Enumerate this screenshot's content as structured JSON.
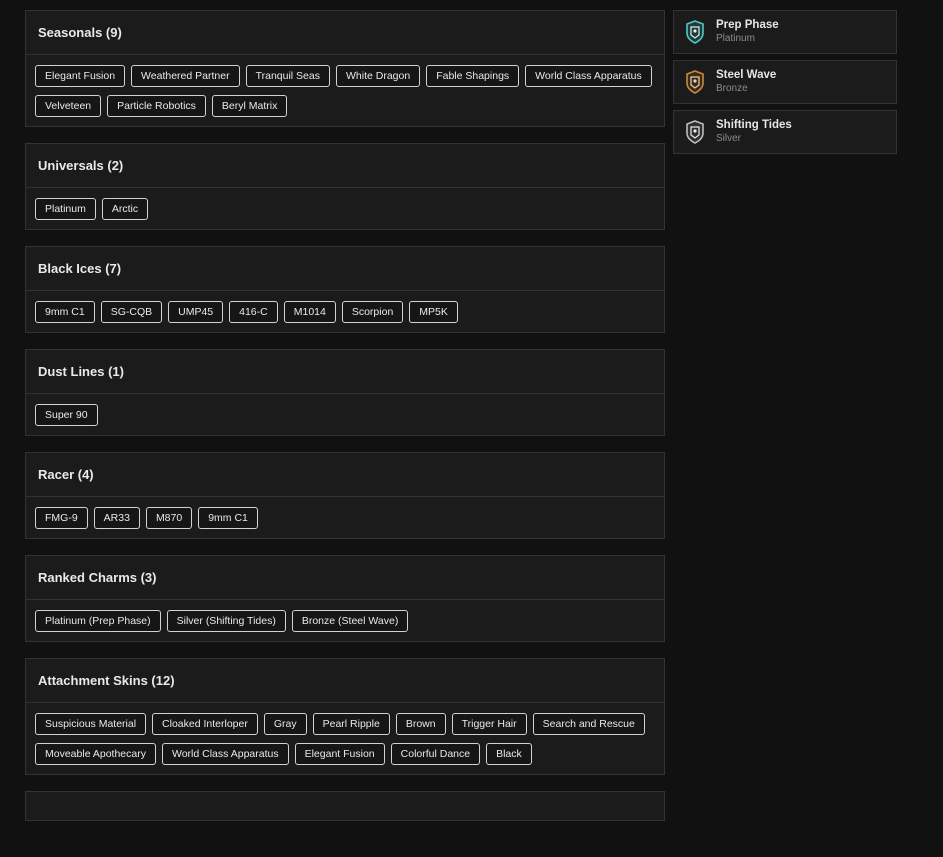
{
  "sections": [
    {
      "title": "Seasonals (9)",
      "tags": [
        "Elegant Fusion",
        "Weathered Partner",
        "Tranquil Seas",
        "White Dragon",
        "Fable Shapings",
        "World Class Apparatus",
        "Velveteen",
        "Particle Robotics",
        "Beryl Matrix"
      ]
    },
    {
      "title": "Universals (2)",
      "tags": [
        "Platinum",
        "Arctic"
      ]
    },
    {
      "title": "Black Ices (7)",
      "tags": [
        "9mm C1",
        "SG-CQB",
        "UMP45",
        "416-C",
        "M1014",
        "Scorpion",
        "MP5K"
      ]
    },
    {
      "title": "Dust Lines (1)",
      "tags": [
        "Super 90"
      ]
    },
    {
      "title": "Racer (4)",
      "tags": [
        "FMG-9",
        "AR33",
        "M870",
        "9mm C1"
      ]
    },
    {
      "title": "Ranked Charms (3)",
      "tags": [
        "Platinum (Prep Phase)",
        "Silver (Shifting Tides)",
        "Bronze (Steel Wave)"
      ]
    },
    {
      "title": "Attachment Skins (12)",
      "tags": [
        "Suspicious Material",
        "Cloaked Interloper",
        "Gray",
        "Pearl Ripple",
        "Brown",
        "Trigger Hair",
        "Search and Rescue",
        "Moveable Apothecary",
        "World Class Apparatus",
        "Elegant Fusion",
        "Colorful Dance",
        "Black"
      ]
    }
  ],
  "charms": [
    {
      "name": "Prep Phase",
      "tier": "Platinum",
      "color": "#4fc9c4",
      "icon": "platinum-rank-charm-icon"
    },
    {
      "name": "Steel Wave",
      "tier": "Bronze",
      "color": "#c98a3c",
      "icon": "bronze-rank-charm-icon"
    },
    {
      "name": "Shifting Tides",
      "tier": "Silver",
      "color": "#bdbdbd",
      "icon": "silver-rank-charm-icon"
    }
  ]
}
